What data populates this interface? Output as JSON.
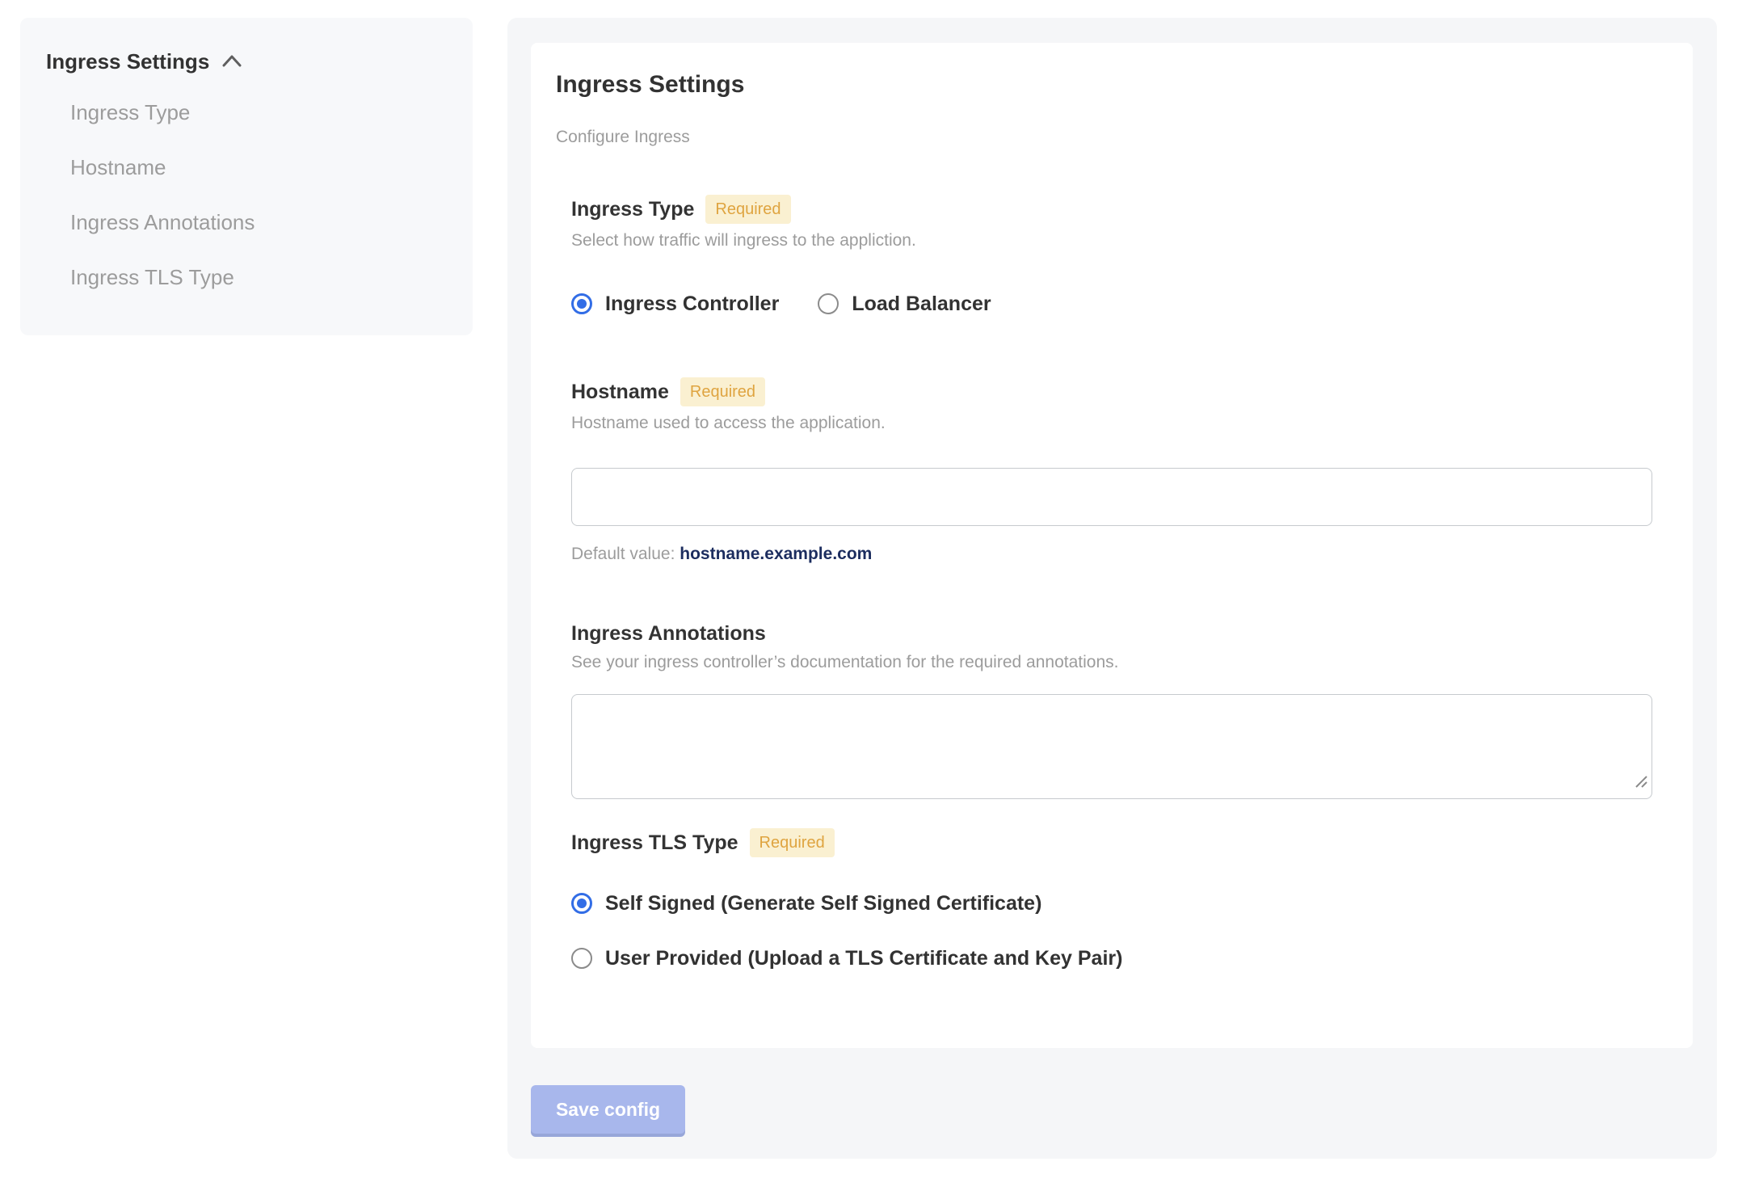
{
  "colors": {
    "accent_blue": "#326de6",
    "badge_bg": "#faf0d1",
    "badge_text": "#dfa440",
    "default_value_navy": "#1c2d5f",
    "save_button_bg": "#a8b7ec",
    "panel_bg": "#f5f6f8",
    "sidebar_bg": "#f7f8fa",
    "muted_text": "#9c9c9c"
  },
  "icons": {
    "sidebar_collapse": "chevron-up-icon",
    "textarea_resize": "resize-grip-icon"
  },
  "sidebar": {
    "title": "Ingress Settings",
    "items": [
      {
        "label": "Ingress Type"
      },
      {
        "label": "Hostname"
      },
      {
        "label": "Ingress Annotations"
      },
      {
        "label": "Ingress TLS Type"
      }
    ]
  },
  "main": {
    "title": "Ingress Settings",
    "subtitle": "Configure Ingress",
    "fields": [
      {
        "id": "ingress-type",
        "label": "Ingress Type",
        "badge": "Required",
        "help": "Select how traffic will ingress to the appliction.",
        "type": "radio-inline",
        "options": [
          {
            "label": "Ingress Controller",
            "selected": true
          },
          {
            "label": "Load Balancer",
            "selected": false
          }
        ]
      },
      {
        "id": "hostname",
        "label": "Hostname",
        "badge": "Required",
        "help": "Hostname used to access the application.",
        "type": "text",
        "value": "",
        "default_prefix": "Default value: ",
        "default_value": "hostname.example.com"
      },
      {
        "id": "ingress-annotations",
        "label": "Ingress Annotations",
        "help": "See your ingress controller’s documentation for the required annotations.",
        "type": "textarea",
        "value": ""
      },
      {
        "id": "ingress-tls-type",
        "label": "Ingress TLS Type",
        "badge": "Required",
        "type": "radio-stacked",
        "options": [
          {
            "label": "Self Signed (Generate Self Signed Certificate)",
            "selected": true
          },
          {
            "label": "User Provided (Upload a TLS Certificate and Key Pair)",
            "selected": false
          }
        ]
      }
    ],
    "save_button": {
      "label": "Save config"
    }
  }
}
